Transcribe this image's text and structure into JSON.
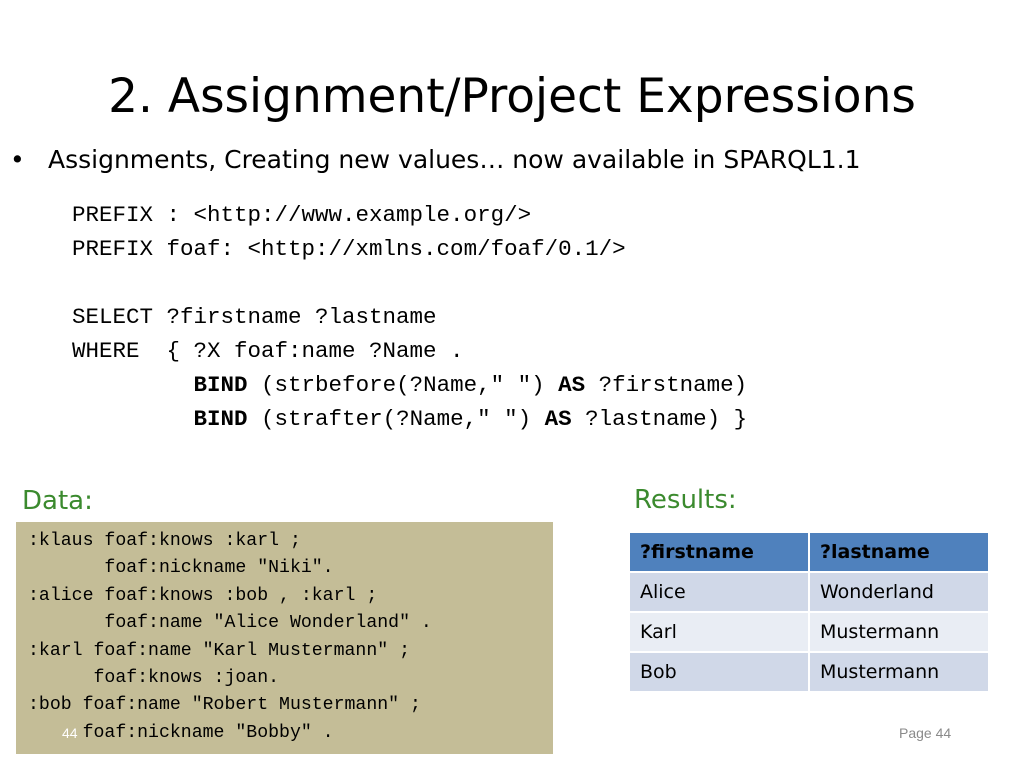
{
  "slide": {
    "title": "2. Assignment/Project Expressions",
    "bullet_marker": "•",
    "bullet_text": "Assignments, Creating new values… now available in SPARQL1.1",
    "query": {
      "line1": "PREFIX : <http://www.example.org/>",
      "line2": "PREFIX foaf: <http://xmlns.com/foaf/0.1/>",
      "line3": "SELECT ?firstname ?lastname",
      "line4": "WHERE  { ?X foaf:name ?Name .",
      "bind1_kw": "BIND",
      "bind1_expr": " (strbefore(?Name,\" \") ",
      "bind1_as": "AS",
      "bind1_var": " ?firstname)",
      "bind2_kw": "BIND",
      "bind2_expr": " (strafter(?Name,\" \") ",
      "bind2_as": "AS",
      "bind2_var": " ?lastname) }"
    },
    "data_label": "Data:",
    "data_lines": [
      ":klaus foaf:knows :karl ;",
      "       foaf:nickname \"Niki\".",
      ":alice foaf:knows :bob , :karl ;",
      "       foaf:name \"Alice Wonderland\" .",
      ":karl foaf:name \"Karl Mustermann\" ;",
      "      foaf:knows :joan.",
      ":bob foaf:name \"Robert Mustermann\" ;",
      "     foaf:nickname \"Bobby\" ."
    ],
    "slide_number": "44",
    "results_label": "Results:",
    "results": {
      "headers": [
        "?firstname",
        "?lastname"
      ],
      "rows": [
        [
          "Alice",
          "Wonderland"
        ],
        [
          "Karl",
          "Mustermann"
        ],
        [
          "Bob",
          "Mustermann"
        ]
      ]
    },
    "page_label": "Page 44",
    "colors": {
      "header_blue": "#4f81bd",
      "row_odd": "#d0d8e8",
      "row_even": "#e9edf4",
      "data_box": "#c4bd97",
      "label_green": "#3b8a2e"
    }
  }
}
